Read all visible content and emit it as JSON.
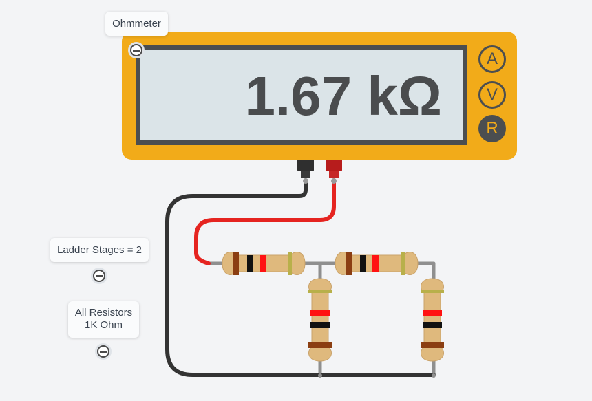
{
  "meter": {
    "title": "Ohmmeter",
    "reading": "1.67 kΩ",
    "modes": [
      {
        "label": "A",
        "active": false
      },
      {
        "label": "V",
        "active": false
      },
      {
        "label": "R",
        "active": true
      }
    ]
  },
  "controls": {
    "ladder_stages": "Ladder Stages = 2",
    "resistors_line1": "All Resistors",
    "resistors_line2": "1K Ohm"
  },
  "colors": {
    "meter_body": "#f2ab19",
    "screen": "#dbe4e8",
    "wire_black": "#333333",
    "wire_red": "#e52420",
    "resistor_body": "#dfb97d",
    "band_brown": "#8b3e12",
    "band_black": "#111111",
    "band_red": "#ff1212",
    "band_gold": "#b8b04a"
  }
}
